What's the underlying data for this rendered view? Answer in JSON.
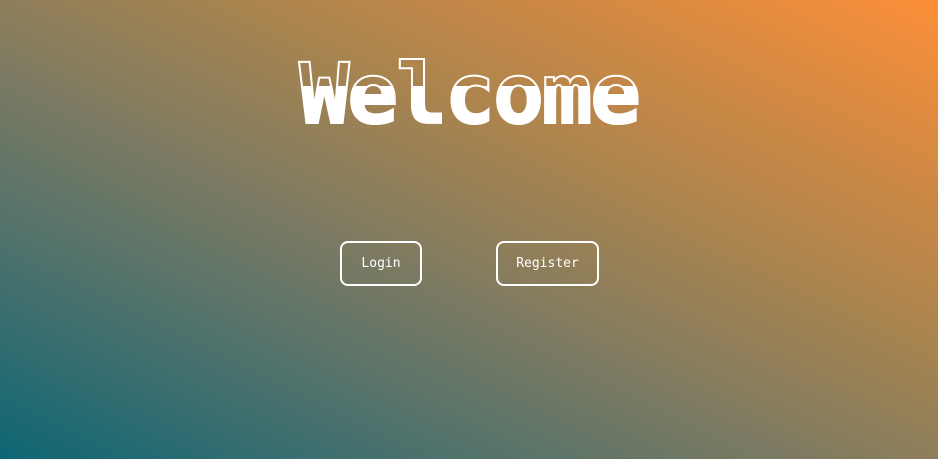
{
  "hero": {
    "title": "Welcome"
  },
  "actions": {
    "login_label": "Login",
    "register_label": "Register"
  },
  "colors": {
    "gradient_start": "#0d6674",
    "gradient_end": "#fc8f39",
    "text": "#ffffff"
  }
}
